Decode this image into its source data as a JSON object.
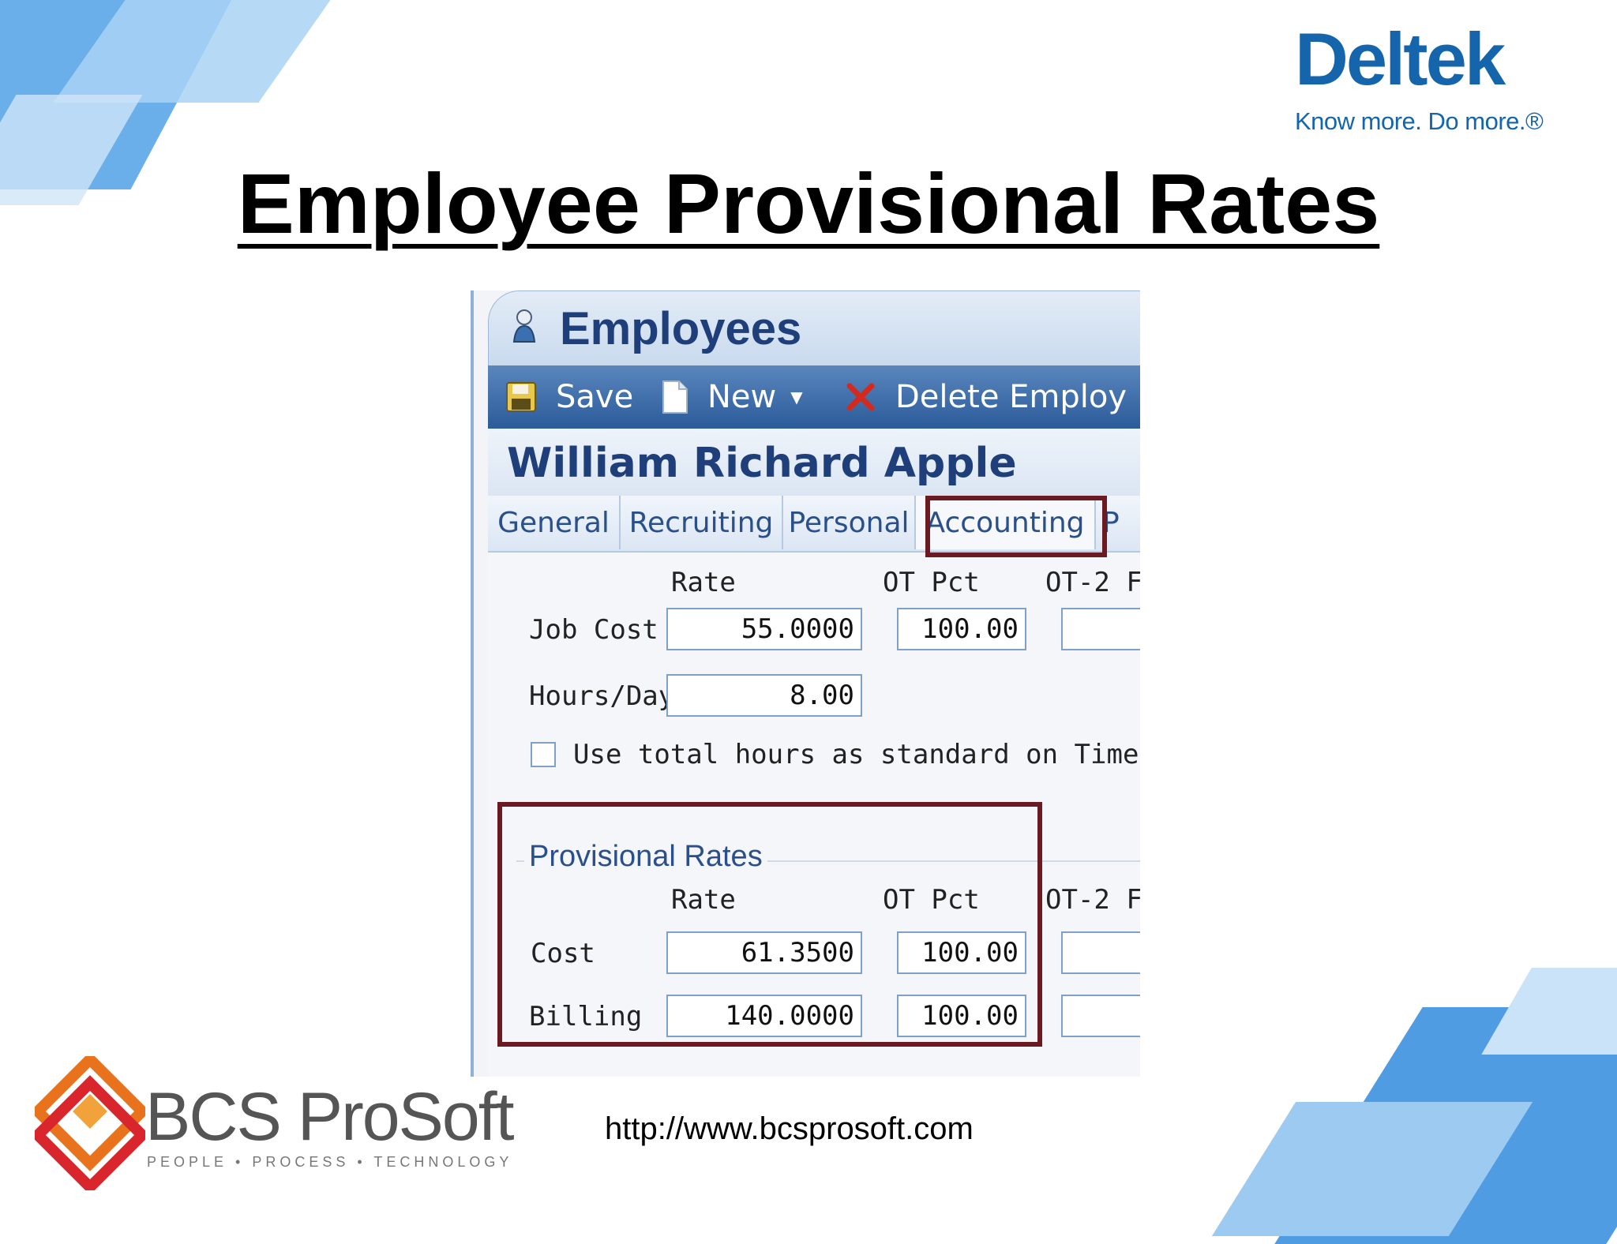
{
  "slide": {
    "title": "Employee Provisional Rates",
    "url": "http://www.bcsprosoft.com"
  },
  "deltek_logo": {
    "word": "Deltek",
    "tagline": "Know more. Do more.®",
    "color": "#1565ad"
  },
  "bcs_logo": {
    "word": "BCS ProSoft",
    "tagline": "PEOPLE • PROCESS • TECHNOLOGY"
  },
  "app": {
    "title": "Employees",
    "toolbar": {
      "save_label": "Save",
      "new_label": "New",
      "delete_label": "Delete Employ"
    },
    "employee_name": "William Richard Apple",
    "tabs": [
      "General",
      "Recruiting",
      "Personal",
      "Accounting",
      "P"
    ],
    "active_tab": "Accounting",
    "rates": {
      "rate_header": "Rate",
      "ot_pct_header": "OT Pct",
      "ot2_header": "OT-2 F",
      "job_cost_label": "Job Cost",
      "job_cost_rate": "55.0000",
      "job_cost_ot_pct": "100.00",
      "hours_day_label": "Hours/Day",
      "hours_day_value": "8.00",
      "checkbox_label": "Use total hours as standard on Time Anal",
      "checkbox_checked": false
    },
    "provisional": {
      "group_title": "Provisional Rates",
      "rate_header": "Rate",
      "ot_pct_header": "OT Pct",
      "ot2_header": "OT-2 F",
      "cost_label": "Cost",
      "cost_rate": "61.3500",
      "cost_ot_pct": "100.00",
      "billing_label": "Billing",
      "billing_rate": "140.0000",
      "billing_ot_pct": "100.00"
    }
  },
  "colors": {
    "highlight": "#6b1a22",
    "toolbar": "#2b5b99",
    "accent": "#1f3f7a"
  }
}
